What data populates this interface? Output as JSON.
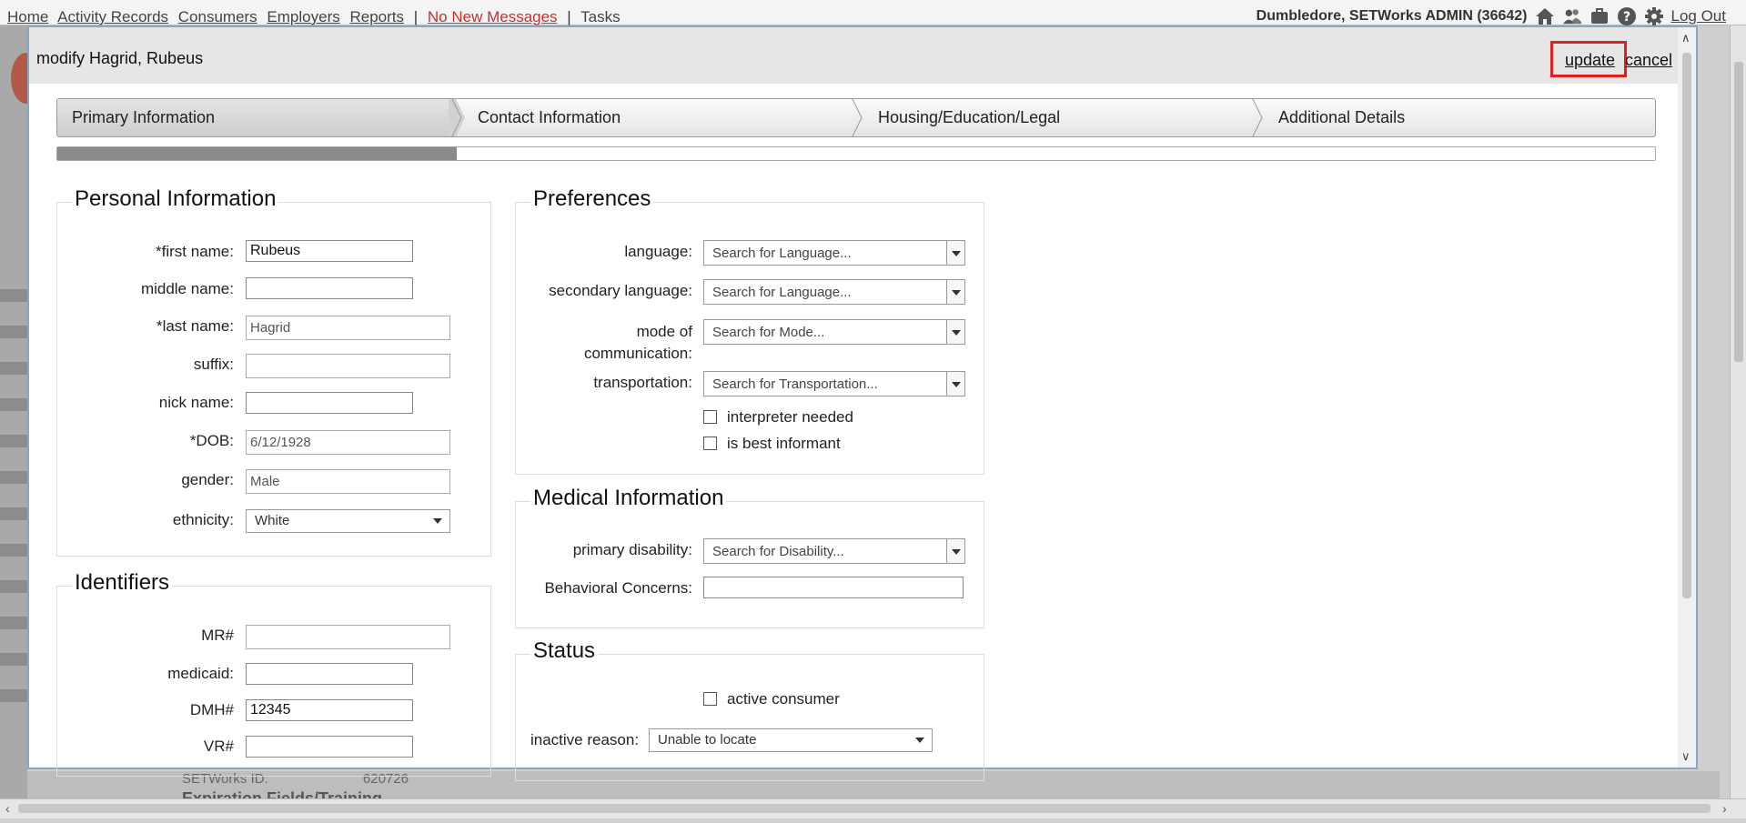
{
  "topnav": {
    "links": [
      "Home",
      "Activity Records",
      "Consumers",
      "Employers",
      "Reports"
    ],
    "messages": "No New Messages",
    "tasks": "Tasks",
    "user": "Dumbledore, SETWorks ADMIN (36642)",
    "logout": "Log Out",
    "icons": [
      "home-icon",
      "users-icon",
      "briefcase-icon",
      "help-icon",
      "gear-icon"
    ]
  },
  "background": {
    "setworks_id_label": "SETWorks ID:",
    "setworks_id_value": "620726",
    "section_heading": "Expiration Fields/Training"
  },
  "modal": {
    "title": "modify Hagrid, Rubeus",
    "update": "update",
    "cancel": "cancel",
    "highlight_color": "#e02020"
  },
  "steps": [
    {
      "label": "Primary Information",
      "active": true
    },
    {
      "label": "Contact Information",
      "active": false
    },
    {
      "label": "Housing/Education/Legal",
      "active": false
    },
    {
      "label": "Additional Details",
      "active": false
    }
  ],
  "progress": {
    "percent": 25
  },
  "personal": {
    "legend": "Personal Information",
    "first_name": {
      "label": "*first name:",
      "value": "Rubeus"
    },
    "middle_name": {
      "label": "middle name:",
      "value": ""
    },
    "last_name": {
      "label": "*last name:",
      "value": "Hagrid"
    },
    "suffix": {
      "label": "suffix:",
      "value": ""
    },
    "nick_name": {
      "label": "nick name:",
      "value": ""
    },
    "dob": {
      "label": "*DOB:",
      "value": "6/12/1928"
    },
    "gender": {
      "label": "gender:",
      "value": "Male"
    },
    "ethnicity": {
      "label": "ethnicity:",
      "value": "White"
    }
  },
  "identifiers": {
    "legend": "Identifiers",
    "mr": {
      "label": "MR#",
      "value": ""
    },
    "medicaid": {
      "label": "medicaid:",
      "value": ""
    },
    "dmh": {
      "label": "DMH#",
      "value": "12345"
    },
    "vr": {
      "label": "VR#",
      "value": ""
    }
  },
  "preferences": {
    "legend": "Preferences",
    "language": {
      "label": "language:",
      "placeholder": "Search for Language..."
    },
    "secondary_language": {
      "label": "secondary language:",
      "placeholder": "Search for Language..."
    },
    "mode": {
      "label": "mode of communication:",
      "placeholder": "Search for Mode..."
    },
    "transportation": {
      "label": "transportation:",
      "placeholder": "Search for Transportation..."
    },
    "interpreter_needed": {
      "label": "interpreter needed",
      "checked": false
    },
    "best_informant": {
      "label": "is best informant",
      "checked": false
    }
  },
  "medical": {
    "legend": "Medical Information",
    "primary_disability": {
      "label": "primary disability:",
      "placeholder": "Search for Disability..."
    },
    "behavioral": {
      "label": "Behavioral Concerns:",
      "value": ""
    }
  },
  "status": {
    "legend": "Status",
    "active_consumer": {
      "label": "active consumer",
      "checked": false
    },
    "inactive_reason": {
      "label": "inactive reason:",
      "value": "Unable to locate"
    }
  }
}
